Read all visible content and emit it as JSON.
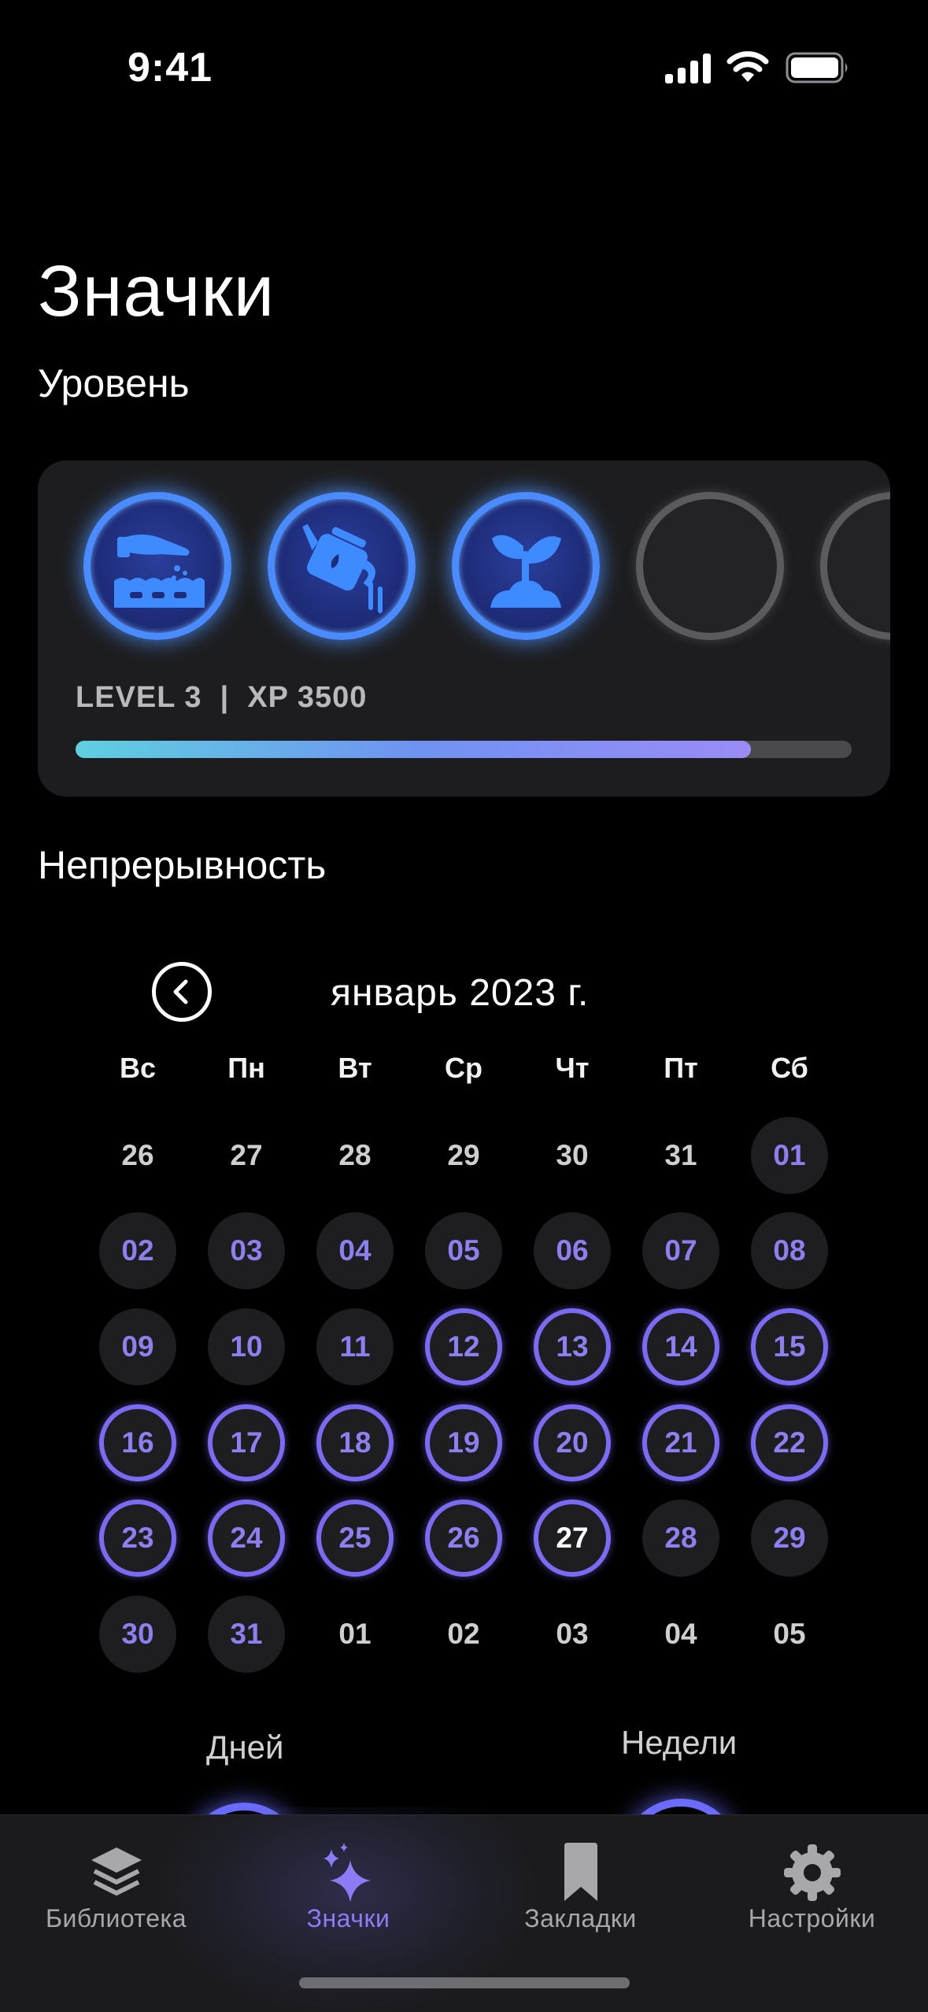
{
  "status_bar": {
    "time": "9:41",
    "icons": [
      "cellular-signal-icon",
      "wifi-icon",
      "battery-icon"
    ]
  },
  "page": {
    "title": "Значки"
  },
  "level": {
    "section_title": "Уровень",
    "level_text": "LEVEL 3  |  XP 3500",
    "progress_fraction": 0.87,
    "badges": [
      {
        "name": "planting-seeds-icon",
        "state": "earned"
      },
      {
        "name": "watering-can-icon",
        "state": "earned"
      },
      {
        "name": "sprout-icon",
        "state": "earned"
      },
      {
        "name": "locked-badge",
        "state": "locked"
      },
      {
        "name": "locked-badge",
        "state": "locked"
      }
    ],
    "colors": {
      "earned_ring": "#4a8bff",
      "locked_ring": "#5b5b5e",
      "progress_start": "#5fd0e0",
      "progress_end": "#9b8bf7"
    }
  },
  "streak": {
    "section_title": "Непрерывность",
    "month_label": "январь 2023 г.",
    "weekdays": [
      "Вс",
      "Пн",
      "Вт",
      "Ср",
      "Чт",
      "Пт",
      "Сб"
    ],
    "days": [
      {
        "label": "26",
        "style": "other"
      },
      {
        "label": "27",
        "style": "other"
      },
      {
        "label": "28",
        "style": "other"
      },
      {
        "label": "29",
        "style": "other"
      },
      {
        "label": "30",
        "style": "other"
      },
      {
        "label": "31",
        "style": "other"
      },
      {
        "label": "01",
        "style": "muted"
      },
      {
        "label": "02",
        "style": "muted"
      },
      {
        "label": "03",
        "style": "muted"
      },
      {
        "label": "04",
        "style": "muted"
      },
      {
        "label": "05",
        "style": "muted"
      },
      {
        "label": "06",
        "style": "muted"
      },
      {
        "label": "07",
        "style": "muted"
      },
      {
        "label": "08",
        "style": "muted"
      },
      {
        "label": "09",
        "style": "muted"
      },
      {
        "label": "10",
        "style": "muted"
      },
      {
        "label": "11",
        "style": "muted"
      },
      {
        "label": "12",
        "style": "ring"
      },
      {
        "label": "13",
        "style": "ring"
      },
      {
        "label": "14",
        "style": "ring"
      },
      {
        "label": "15",
        "style": "ring"
      },
      {
        "label": "16",
        "style": "ring"
      },
      {
        "label": "17",
        "style": "ring"
      },
      {
        "label": "18",
        "style": "ring"
      },
      {
        "label": "19",
        "style": "ring"
      },
      {
        "label": "20",
        "style": "ring"
      },
      {
        "label": "21",
        "style": "ring"
      },
      {
        "label": "22",
        "style": "ring"
      },
      {
        "label": "23",
        "style": "ring"
      },
      {
        "label": "24",
        "style": "ring"
      },
      {
        "label": "25",
        "style": "ring"
      },
      {
        "label": "26",
        "style": "ring"
      },
      {
        "label": "27",
        "style": "today"
      },
      {
        "label": "28",
        "style": "muted"
      },
      {
        "label": "29",
        "style": "muted"
      },
      {
        "label": "30",
        "style": "muted"
      },
      {
        "label": "31",
        "style": "muted"
      },
      {
        "label": "01",
        "style": "other"
      },
      {
        "label": "02",
        "style": "other"
      },
      {
        "label": "03",
        "style": "other"
      },
      {
        "label": "04",
        "style": "other"
      },
      {
        "label": "05",
        "style": "other"
      }
    ],
    "days_label": "Дней",
    "weeks_label": "Недели",
    "colors": {
      "accent": "#7b6bf2",
      "day_text": "#8c7ff0"
    }
  },
  "tab_bar": {
    "tabs": [
      {
        "label": "Библиотека",
        "icon": "stacked-layers-icon",
        "active": false
      },
      {
        "label": "Значки",
        "icon": "sparkles-icon",
        "active": true
      },
      {
        "label": "Закладки",
        "icon": "bookmark-icon",
        "active": false
      },
      {
        "label": "Настройки",
        "icon": "gear-icon",
        "active": false
      }
    ],
    "active_color": "#8b7cf5"
  }
}
